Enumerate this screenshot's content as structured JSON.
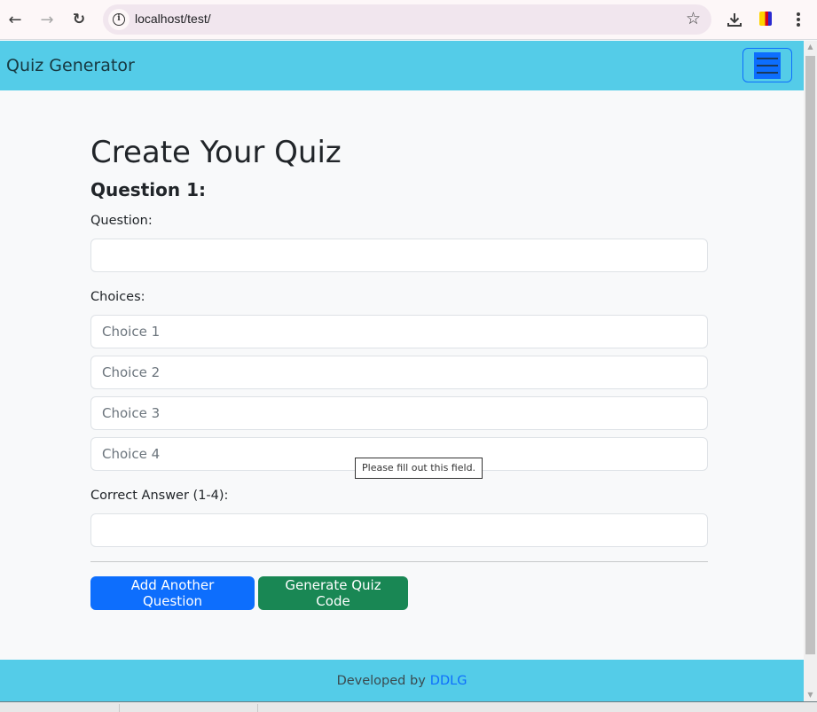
{
  "browser": {
    "url": "localhost/test/",
    "icons": {
      "back": "arrow-left-icon",
      "forward": "arrow-right-icon",
      "reload": "reload-icon",
      "site_info": "info-icon",
      "bookmark": "star-icon",
      "download": "download-icon",
      "extension": "extension-icon",
      "menu": "kebab-menu-icon"
    }
  },
  "navbar": {
    "brand": "Quiz Generator",
    "toggler_icon": "hamburger-menu-icon"
  },
  "main": {
    "title": "Create Your Quiz",
    "question_heading": "Question 1:",
    "question_label": "Question:",
    "question_value": "",
    "choices_label": "Choices:",
    "choices": [
      {
        "placeholder": "Choice 1",
        "value": ""
      },
      {
        "placeholder": "Choice 2",
        "value": ""
      },
      {
        "placeholder": "Choice 3",
        "value": ""
      },
      {
        "placeholder": "Choice 4",
        "value": ""
      }
    ],
    "correct_label": "Correct Answer (1-4):",
    "correct_value": "",
    "validation_tooltip": "Please fill out this field.",
    "buttons": {
      "add_question": "Add Another Question",
      "generate": "Generate Quiz Code"
    }
  },
  "footer": {
    "text": "Developed by",
    "link": "DDLG"
  },
  "colors": {
    "navbar_bg": "#54cce8",
    "primary": "#0d6efd",
    "success": "#198754",
    "page_bg": "#f8f9fa"
  }
}
